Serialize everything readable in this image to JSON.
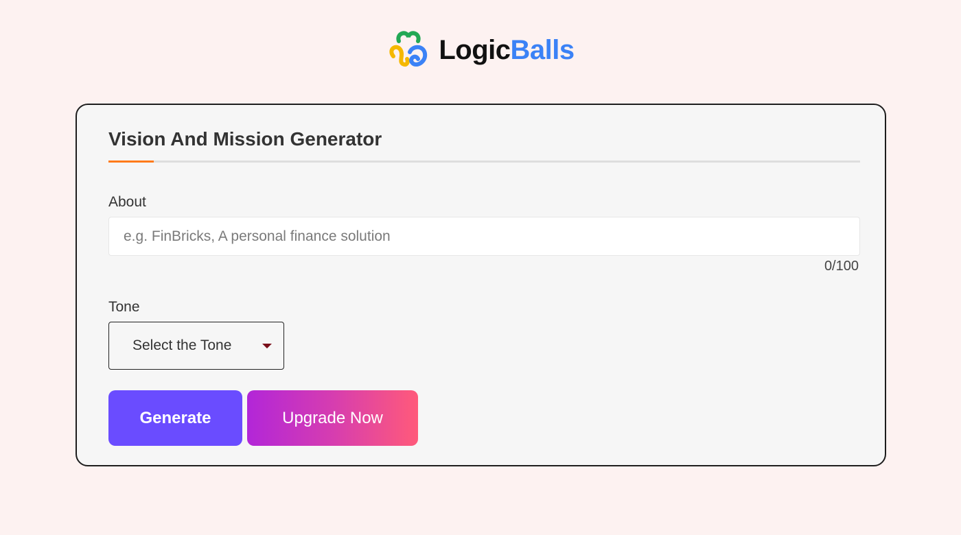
{
  "brand": {
    "name_part1": "Logic",
    "name_part2": "Balls",
    "logo_icon": "logicballs-knot-icon",
    "colors": {
      "dark": "#111111",
      "blue": "#3b82f6",
      "green": "#22a855",
      "yellow": "#f5b800"
    }
  },
  "form": {
    "title": "Vision And Mission Generator",
    "accent_color": "#ff7a1a",
    "about": {
      "label": "About",
      "placeholder": "e.g. FinBricks, A personal finance solution",
      "value": "",
      "char_count": "0/100"
    },
    "tone": {
      "label": "Tone",
      "selected": "Select the Tone",
      "icon": "caret-down-icon"
    },
    "buttons": {
      "generate": "Generate",
      "upgrade": "Upgrade Now"
    },
    "colors": {
      "generate_bg": "#6a4cff",
      "upgrade_gradient": [
        "#b226d8",
        "#ff5a7a"
      ]
    }
  }
}
